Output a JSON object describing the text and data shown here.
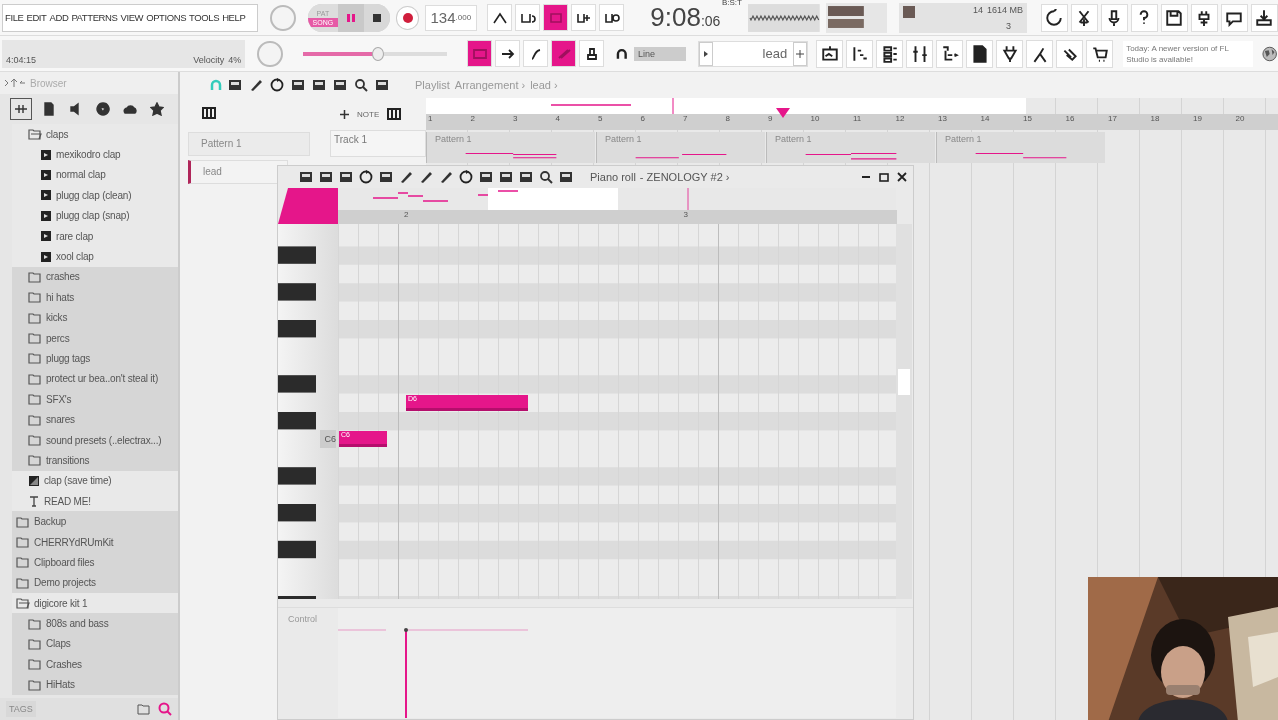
{
  "menu": [
    "FILE",
    "EDIT",
    "ADD",
    "PATTERNS",
    "VIEW",
    "OPTIONS",
    "TOOLS",
    "HELP"
  ],
  "transport": {
    "modes": [
      {
        "label": "PAT",
        "selected": false
      },
      {
        "label": "SONG",
        "selected": true
      }
    ],
    "tempo": "134",
    "tempo_fraction": ".000"
  },
  "time": {
    "main": "9:08",
    "sub": ":06",
    "caption": "B:S:T"
  },
  "monitor": {
    "cpu": "14",
    "memory": "1614 MB",
    "polyphony": "3"
  },
  "toggles_top": [
    {
      "on": false
    },
    {
      "on": false
    },
    {
      "on": true
    },
    {
      "on": false
    },
    {
      "on": false
    }
  ],
  "song_position": "4:04:15",
  "velocity": {
    "label": "Velocity",
    "value": "4%"
  },
  "master": {
    "level": 0.52
  },
  "toggles_bottom": [
    {
      "on": true
    },
    {
      "on": false
    },
    {
      "on": false
    },
    {
      "on": true
    },
    {
      "on": false
    }
  ],
  "snap": "Line",
  "pattern_selector": "lead",
  "news": "Today: A newer version of FL Studio is available!",
  "browser": {
    "title": "Browser",
    "tags": "TAGS",
    "open_folder_items": [
      {
        "kind": "folder",
        "label": "claps",
        "expanded": true,
        "children": [
          {
            "kind": "sample",
            "label": "mexikodro clap"
          },
          {
            "kind": "sample",
            "label": "normal clap"
          },
          {
            "kind": "sample",
            "label": "plugg clap (clean)"
          },
          {
            "kind": "sample",
            "label": "plugg clap (snap)"
          },
          {
            "kind": "sample",
            "label": "rare clap"
          },
          {
            "kind": "sample",
            "label": "xool clap"
          }
        ]
      },
      {
        "kind": "folder",
        "label": "crashes",
        "expanded": false
      },
      {
        "kind": "folder",
        "label": "hi hats",
        "expanded": false
      },
      {
        "kind": "folder",
        "label": "kicks",
        "expanded": false
      },
      {
        "kind": "folder",
        "label": "percs",
        "expanded": false
      },
      {
        "kind": "folder",
        "label": "plugg tags",
        "expanded": false
      },
      {
        "kind": "folder",
        "label": "protect ur bea..on't steal it)",
        "expanded": false
      },
      {
        "kind": "folder",
        "label": "SFX's",
        "expanded": false
      },
      {
        "kind": "folder",
        "label": "snares",
        "expanded": false
      },
      {
        "kind": "folder",
        "label": "sound presets (..electrax...)",
        "expanded": false
      },
      {
        "kind": "folder",
        "label": "transitions",
        "expanded": false
      },
      {
        "kind": "preset",
        "label": "clap (save time)"
      },
      {
        "kind": "text",
        "label": "READ ME!"
      }
    ],
    "items": [
      {
        "kind": "folder",
        "label": "Backup",
        "expanded": false
      },
      {
        "kind": "folder",
        "label": "CHERRYdRUmKit",
        "expanded": false
      },
      {
        "kind": "folder",
        "label": "Clipboard files",
        "expanded": false
      },
      {
        "kind": "folder",
        "label": "Demo projects",
        "expanded": false
      },
      {
        "kind": "folder",
        "label": "digicore kit 1",
        "expanded": true,
        "children": [
          {
            "kind": "folder",
            "label": "808s and bass",
            "expanded": false
          },
          {
            "kind": "folder",
            "label": "Claps",
            "expanded": false
          },
          {
            "kind": "folder",
            "label": "Crashes",
            "expanded": false
          },
          {
            "kind": "folder",
            "label": "HiHats",
            "expanded": false
          }
        ]
      }
    ]
  },
  "playlist": {
    "title": "Playlist",
    "breadcrumb": [
      "Arrangement ›",
      "lead ›"
    ],
    "tool_label": "NOTE",
    "patterns": [
      {
        "label": "Pattern 1",
        "selected": false
      },
      {
        "label": "lead",
        "selected": true
      }
    ],
    "tracks": [
      {
        "label": "Track 1"
      }
    ],
    "bars": [
      "1",
      "2",
      "3",
      "4",
      "5",
      "6",
      "7",
      "8",
      "9",
      "10",
      "11",
      "12",
      "13",
      "14",
      "15",
      "16",
      "17",
      "18",
      "19",
      "20"
    ],
    "clips": [
      {
        "label": "Pattern 1"
      },
      {
        "label": "Pattern 1"
      },
      {
        "label": "Pattern 1"
      },
      {
        "label": "Pattern 1"
      }
    ]
  },
  "piano_roll": {
    "title": "Piano roll",
    "target": "- ZENOLOGY #2 ›",
    "key_label": "C6",
    "bars": [
      "2",
      "3"
    ],
    "notes": [
      {
        "label": "D6"
      },
      {
        "label": "C6"
      }
    ],
    "control_label": "Control"
  }
}
